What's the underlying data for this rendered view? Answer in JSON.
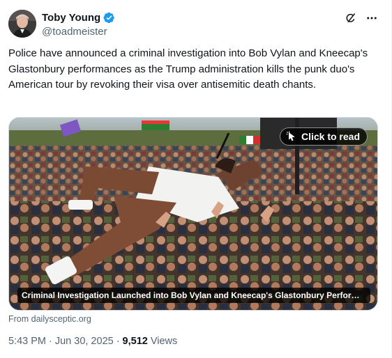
{
  "author": {
    "display_name": "Toby Young",
    "handle": "@toadmeister",
    "verified": true,
    "verified_color": "#1d9bf0"
  },
  "header_icons": [
    "grok-icon",
    "more-icon"
  ],
  "tweet": {
    "text": "Police have announced a criminal investigation into Bob Vylan and Kneecap's Glastonbury performances as the Trump administration kills the punk duo's American tour by revoking their visa over antisemitic death chants."
  },
  "card": {
    "click_label": "Click to read",
    "caption": "Criminal Investigation Launched into Bob Vylan and Kneecap's Glastonbury Performances",
    "source": "From dailysceptic.org"
  },
  "meta": {
    "time": "5:43 PM",
    "separator": "·",
    "date": "Jun 30, 2025",
    "views_count": "9,512",
    "views_label": "Views"
  }
}
